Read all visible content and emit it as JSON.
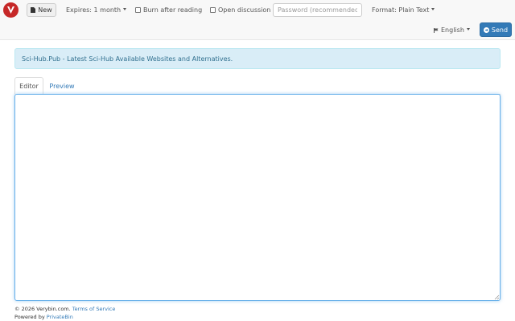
{
  "navbar": {
    "logo_icon": "verybin-logo-icon",
    "new_button": {
      "label": "New",
      "icon": "document-icon"
    },
    "expires": "Expires: 1 month",
    "burn_after_reading": {
      "label": "Burn after reading",
      "checked": false
    },
    "open_discussion": {
      "label": "Open discussion",
      "checked": false
    },
    "password": {
      "value": "",
      "placeholder": "Password (recommended)"
    },
    "format": "Format: Plain Text",
    "language": {
      "label": "English",
      "icon": "flag-icon"
    },
    "send_button": {
      "label": "Send",
      "icon": "arrow-circle-icon"
    }
  },
  "alert": {
    "text": "Sci-Hub.Pub - Latest Sci-Hub Available Websites and Alternatives."
  },
  "tabs": [
    {
      "label": "Editor",
      "active": true
    },
    {
      "label": "Preview",
      "active": false
    }
  ],
  "editor": {
    "value": ""
  },
  "footer": {
    "copyright": "© 2026 Verybin.com.",
    "terms": "Terms of Service",
    "powered_by": "Powered by",
    "privatebin": "PrivateBin"
  },
  "colors": {
    "brand": "#c62828",
    "primary": "#337ab7",
    "alert_bg": "#d9edf7",
    "alert_text": "#31708f"
  }
}
